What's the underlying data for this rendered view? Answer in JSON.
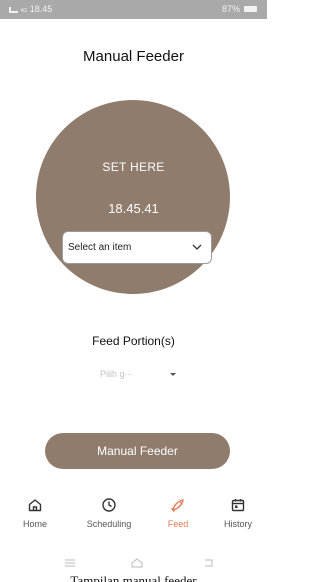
{
  "status_bar": {
    "time": "18.45",
    "signal_text": "4G",
    "battery": "87%"
  },
  "screen": {
    "title": "Manual Feeder"
  },
  "setter": {
    "heading": "SET HERE",
    "time_value": "18.45.41",
    "select_value": "Select an item"
  },
  "portion": {
    "label": "Feed Portion(s)",
    "placeholder": "Pilih g···"
  },
  "action": {
    "manual_feeder_label": "Manual Feeder"
  },
  "bottom_nav": {
    "items": [
      {
        "label": "Home",
        "icon": "home-icon"
      },
      {
        "label": "Scheduling",
        "icon": "clock-icon"
      },
      {
        "label": "Feed",
        "icon": "fish-icon",
        "active": true
      },
      {
        "label": "History",
        "icon": "calendar-icon"
      }
    ]
  },
  "system_nav": {
    "buttons": [
      "menu-icon",
      "home-outline-icon",
      "back-icon"
    ]
  },
  "caption": "Tampilan manual feeder",
  "colors": {
    "accent": "#8f7c6d",
    "active_tab": "#e07a55",
    "status_bar": "#a9a9a9"
  }
}
